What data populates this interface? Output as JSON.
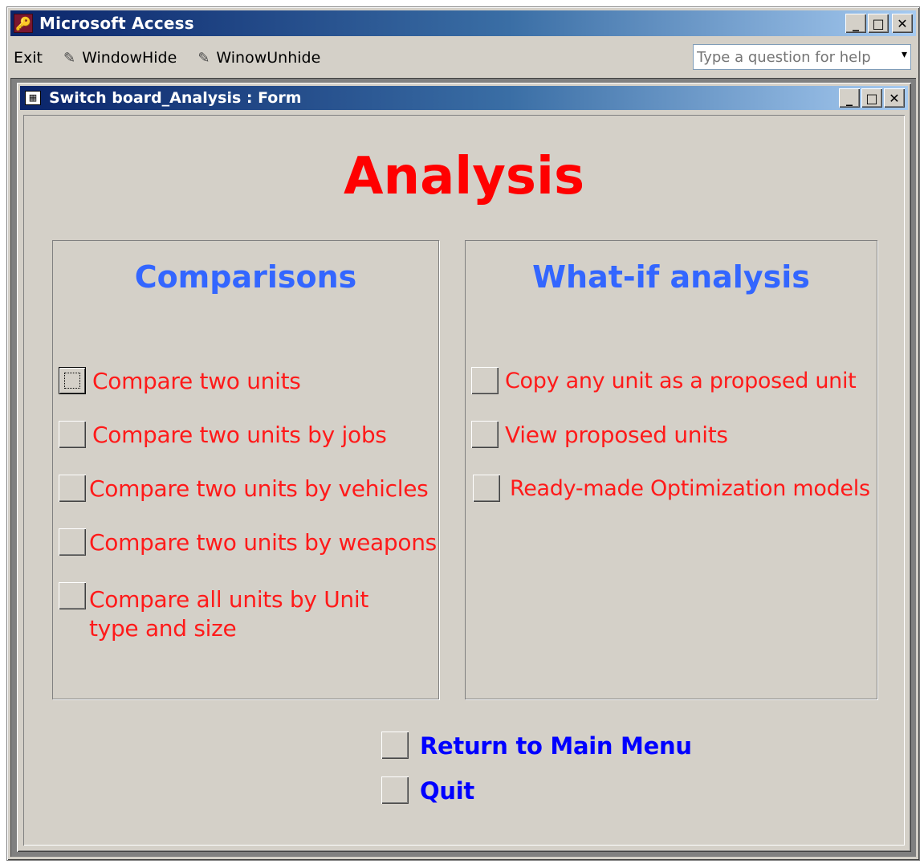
{
  "app": {
    "title": "Microsoft Access",
    "icon_glyph": "🔑",
    "window_buttons": {
      "minimize": "_",
      "maximize": "□",
      "close": "✕"
    }
  },
  "menubar": {
    "items": [
      {
        "label": "Exit",
        "icon": ""
      },
      {
        "label": "WindowHide",
        "icon": "✎"
      },
      {
        "label": "WinowUnhide",
        "icon": "✎"
      }
    ],
    "help_placeholder": "Type a question for help",
    "help_dropdown": "▾"
  },
  "form": {
    "title": "Switch board_Analysis : Form",
    "icon_glyph": "▦",
    "heading": "Analysis",
    "comparisons": {
      "title": "Comparisons",
      "items": [
        "Compare two units",
        "Compare two units by jobs",
        "Compare two units by vehicles",
        "Compare two units by weapons",
        "Compare all units by Unit type and size"
      ]
    },
    "whatif": {
      "title": "What-if analysis",
      "items": [
        "Copy any unit as a proposed unit",
        "View proposed units",
        "Ready-made Optimization models"
      ]
    },
    "bottom": {
      "return_label": "Return to Main Menu",
      "quit_label": "Quit"
    }
  },
  "colors": {
    "heading": "#ff0000",
    "group_title": "#3366ff",
    "item_text": "#ff1a1a",
    "nav_text": "#0000ff",
    "face": "#d4d0c8"
  }
}
